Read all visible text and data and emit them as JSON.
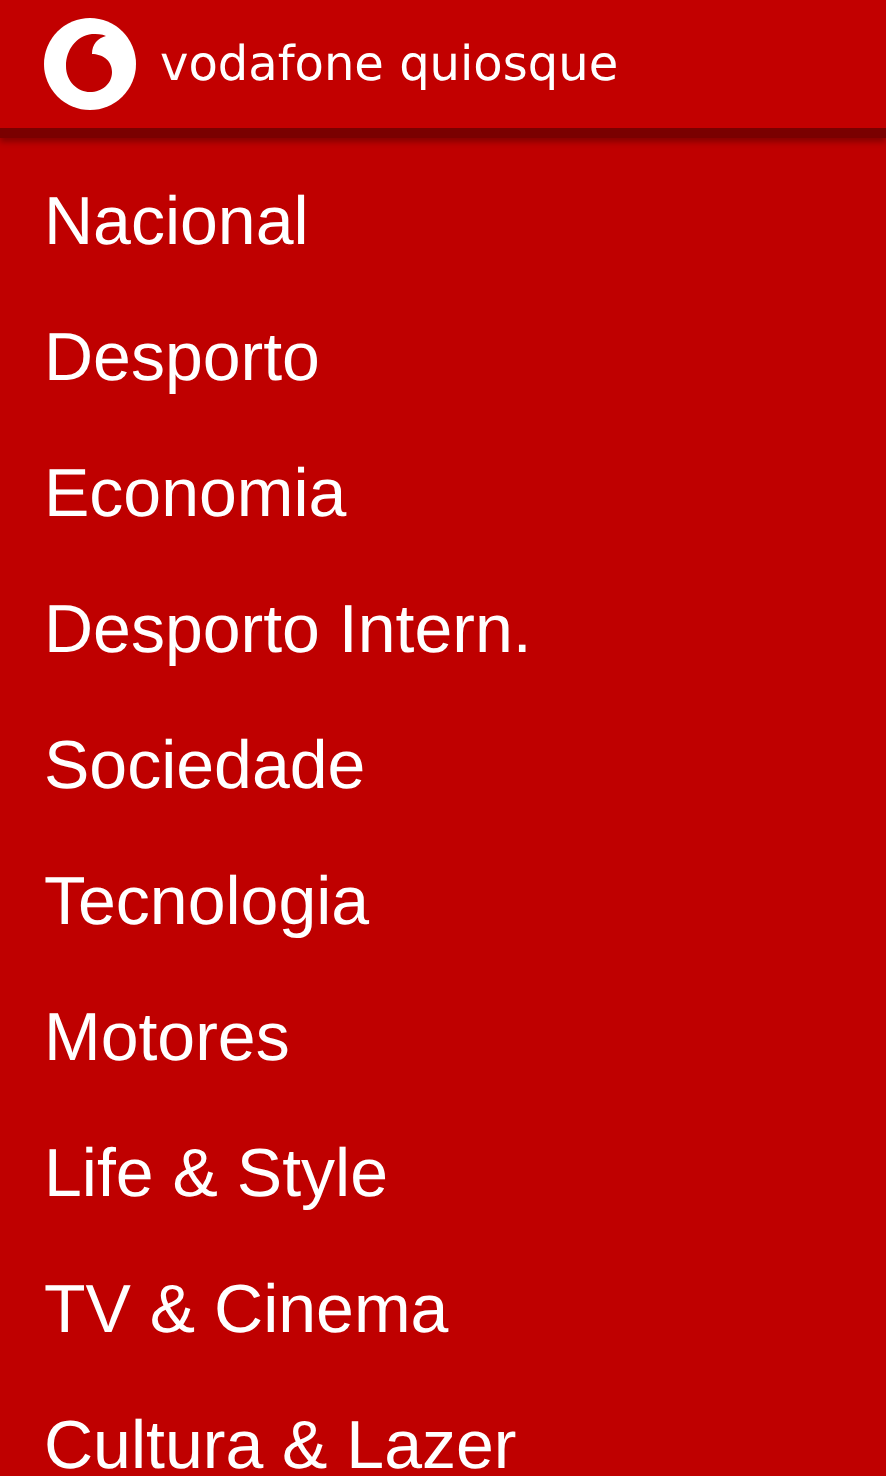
{
  "header": {
    "title": "vodafone quiosque"
  },
  "categories": [
    "Nacional",
    "Desporto",
    "Economia",
    "Desporto Intern.",
    "Sociedade",
    "Tecnologia",
    "Motores",
    "Life & Style",
    "TV & Cinema",
    "Cultura & Lazer"
  ]
}
